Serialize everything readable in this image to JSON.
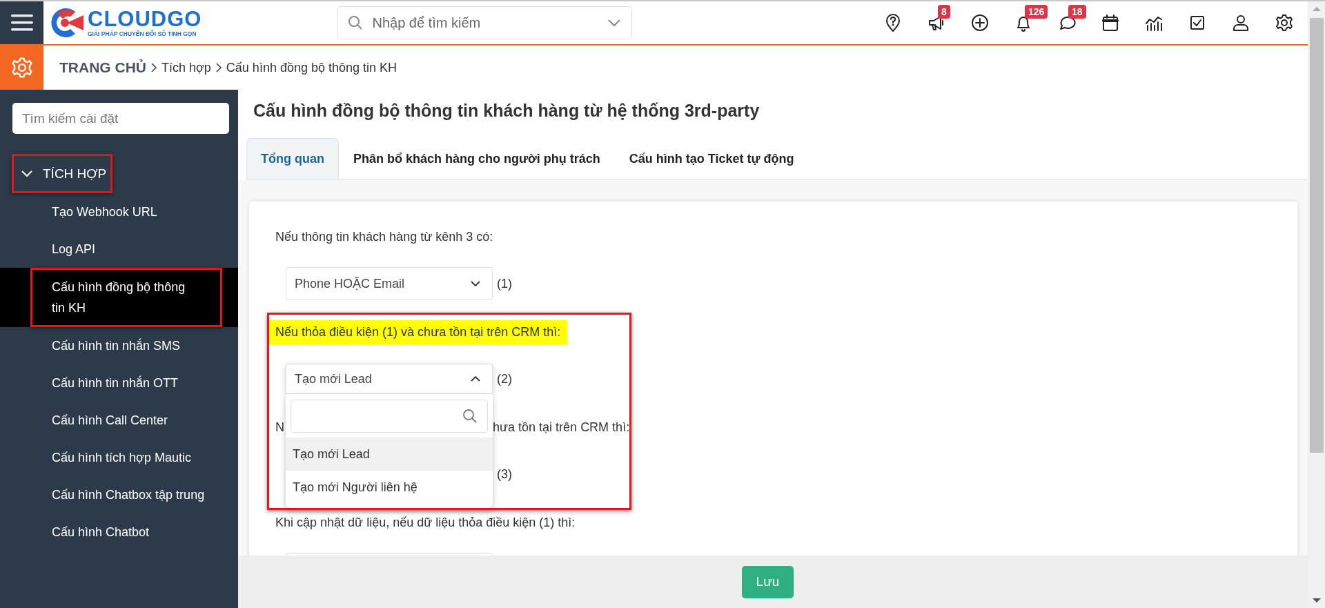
{
  "topbar": {
    "logo": {
      "name": "CLOUDGO",
      "tagline": "GIẢI PHÁP CHUYỂN ĐỔI SỐ TINH GỌN"
    },
    "search": {
      "placeholder": "Nhập để tìm kiếm"
    },
    "icons": [
      {
        "kind": "pin-question"
      },
      {
        "kind": "megaphone",
        "badge": "8"
      },
      {
        "kind": "plus-circle"
      },
      {
        "kind": "bell",
        "badge": "126"
      },
      {
        "kind": "chat",
        "badge": "18"
      },
      {
        "kind": "calendar"
      },
      {
        "kind": "chart"
      },
      {
        "kind": "checkbox"
      },
      {
        "kind": "user"
      },
      {
        "kind": "gear"
      }
    ]
  },
  "breadcrumb": [
    "TRANG CHỦ",
    "Tích hợp",
    "Cấu hình đồng bộ thông tin KH"
  ],
  "sidebar": {
    "search": {
      "placeholder": "Tìm kiếm cài đặt"
    },
    "group": {
      "label": "TÍCH HỢP",
      "expanded": true,
      "annotated": true,
      "items": [
        {
          "label": "Tạo Webhook URL",
          "selected": false,
          "annotated": false
        },
        {
          "label": "Log API",
          "selected": false,
          "annotated": false
        },
        {
          "label": "Cấu hình đồng bộ thông\ntin KH",
          "selected": true,
          "annotated": true
        },
        {
          "label": "Cấu hình tin nhắn SMS",
          "selected": false,
          "annotated": false
        },
        {
          "label": "Cấu hình tin nhắn OTT",
          "selected": false,
          "annotated": false
        },
        {
          "label": "Cấu hình Call Center",
          "selected": false,
          "annotated": false
        },
        {
          "label": "Cấu hình tích hợp Mautic",
          "selected": false,
          "annotated": false
        },
        {
          "label": "Cấu hình Chatbox tập trung",
          "selected": false,
          "annotated": false
        },
        {
          "label": "Cấu hình Chatbot",
          "selected": false,
          "annotated": false
        }
      ]
    }
  },
  "page": {
    "title": "Cấu hình đồng bộ thông tin khách hàng từ hệ thống 3rd-party",
    "tabs": [
      {
        "label": "Tổng quan",
        "selected": true
      },
      {
        "label": "Phân bổ khách hàng cho người phụ trách",
        "selected": false
      },
      {
        "label": "Cấu hình tạo Ticket tự động",
        "selected": false
      }
    ],
    "rows": [
      {
        "label": "Nếu thông tin khách hàng từ kênh 3 có:",
        "highlighted": false,
        "annotated": false,
        "select": {
          "value": "Phone HOẶC Email",
          "open": false
        },
        "number": "(1)"
      },
      {
        "label": "Nếu thỏa điều kiện (1) và chưa tồn tại trên CRM thì:",
        "highlighted": true,
        "annotated": true,
        "select": {
          "value": "Tạo mới Lead",
          "open": true,
          "options": [
            {
              "label": "Tạo mới Lead",
              "selected": true
            },
            {
              "label": "Tạo mới Người liên hệ",
              "selected": false
            }
          ]
        },
        "number": "(2)"
      },
      {
        "label_fragments": [
          "N",
          "hưa tồn tại trên CRM thì:"
        ],
        "highlighted": false,
        "annotated": false,
        "number": "(3)"
      },
      {
        "label": "Khi cập nhật dữ liệu, nếu dữ liệu thỏa điều kiện (1) thì:",
        "highlighted": false,
        "annotated": false,
        "select": {
          "open": false
        }
      }
    ]
  },
  "footer": {
    "button": "Lưu"
  }
}
